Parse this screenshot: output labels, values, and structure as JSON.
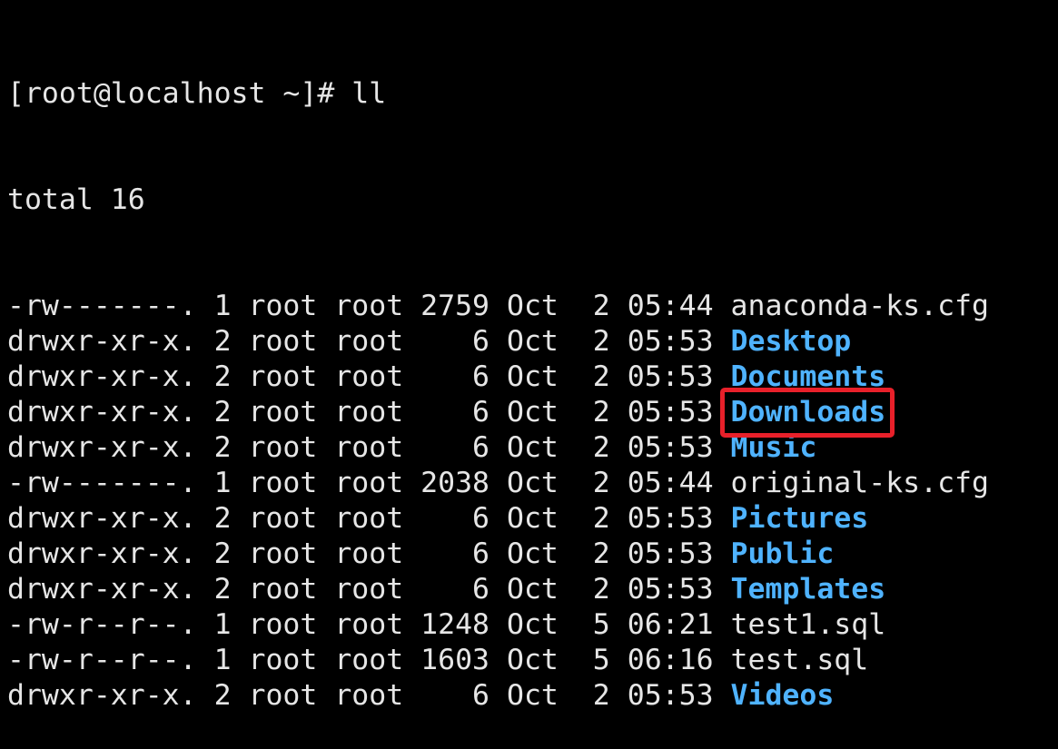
{
  "terminal": {
    "prompt": "[root@localhost ~]# ll",
    "total": "total 16",
    "entries": [
      {
        "meta": "-rw-------. 1 root root 2759 Oct  2 05:44 ",
        "name": "anaconda-ks.cfg",
        "type": "file"
      },
      {
        "meta": "drwxr-xr-x. 2 root root    6 Oct  2 05:53 ",
        "name": "Desktop",
        "type": "dir"
      },
      {
        "meta": "drwxr-xr-x. 2 root root    6 Oct  2 05:53 ",
        "name": "Documents",
        "type": "dir"
      },
      {
        "meta": "drwxr-xr-x. 2 root root    6 Oct  2 05:53 ",
        "name": "Downloads",
        "type": "dir"
      },
      {
        "meta": "drwxr-xr-x. 2 root root    6 Oct  2 05:53 ",
        "name": "Music",
        "type": "dir"
      },
      {
        "meta": "-rw-------. 1 root root 2038 Oct  2 05:44 ",
        "name": "original-ks.cfg",
        "type": "file"
      },
      {
        "meta": "drwxr-xr-x. 2 root root    6 Oct  2 05:53 ",
        "name": "Pictures",
        "type": "dir"
      },
      {
        "meta": "drwxr-xr-x. 2 root root    6 Oct  2 05:53 ",
        "name": "Public",
        "type": "dir"
      },
      {
        "meta": "drwxr-xr-x. 2 root root    6 Oct  2 05:53 ",
        "name": "Templates",
        "type": "dir"
      },
      {
        "meta": "-rw-r--r--. 1 root root 1248 Oct  5 06:21 ",
        "name": "test1.sql",
        "type": "file",
        "highlighted": true
      },
      {
        "meta": "-rw-r--r--. 1 root root 1603 Oct  5 06:16 ",
        "name": "test.sql",
        "type": "file"
      },
      {
        "meta": "drwxr-xr-x. 2 root root    6 Oct  2 05:53 ",
        "name": "Videos",
        "type": "dir"
      }
    ]
  },
  "colors": {
    "background": "#000000",
    "text": "#e6e6e6",
    "directory": "#4fb3ff",
    "highlight_box": "#e8202a"
  }
}
